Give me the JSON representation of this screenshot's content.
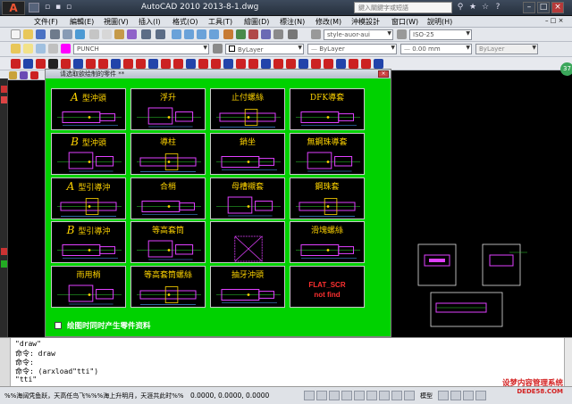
{
  "title_bar": {
    "app_button": "A",
    "title": "AutoCAD 2010    2013-8-1.dwg",
    "search_placeholder": "鍵入關鍵字或短語"
  },
  "menu": [
    "文件(F)",
    "編輯(E)",
    "視圖(V)",
    "插入(I)",
    "格式(O)",
    "工具(T)",
    "繪圖(D)",
    "標注(N)",
    "修改(M)",
    "沖模設計",
    "窗口(W)",
    "說明(H)"
  ],
  "toolbars": {
    "text_style": "style-auor-aui",
    "dim_style": "ISO-25",
    "layer": "PUNCH",
    "color": "ByLayer",
    "linetype": "ByLayer",
    "lineweight": "0.00 mm",
    "plot_style": "ByLayer"
  },
  "dialog": {
    "title": "请选取欲绘制的零件  **",
    "close": "×",
    "cells": [
      {
        "prefix": "A",
        "label": "型沖頭"
      },
      {
        "prefix": "",
        "label": "浮升"
      },
      {
        "prefix": "",
        "label": "止付螺絲"
      },
      {
        "prefix": "",
        "label": "DFK導套"
      },
      {
        "prefix": "B",
        "label": "型沖頭"
      },
      {
        "prefix": "",
        "label": "導柱"
      },
      {
        "prefix": "",
        "label": "銷坐"
      },
      {
        "prefix": "",
        "label": "無鋼珠導套"
      },
      {
        "prefix": "A",
        "label": "型引導沖"
      },
      {
        "prefix": "",
        "label": "合梢"
      },
      {
        "prefix": "",
        "label": "母槽襯套"
      },
      {
        "prefix": "",
        "label": "鋼珠套"
      },
      {
        "prefix": "B",
        "label": "型引導沖"
      },
      {
        "prefix": "",
        "label": "等高套筒"
      },
      {
        "prefix": "",
        "label": ""
      },
      {
        "prefix": "",
        "label": "滑塊螺絲"
      },
      {
        "prefix": "",
        "label": "雨用梢"
      },
      {
        "prefix": "",
        "label": "等高套筒螺絲"
      },
      {
        "prefix": "",
        "label": "抽牙沖頭"
      },
      {
        "prefix": "",
        "label": "FLAT_SCR",
        "sub": "not find"
      }
    ],
    "checkbox_label": "绘图时同时产生零件资料"
  },
  "nav_badge": "37",
  "command": {
    "lines": [
      "\"draw\"",
      "命令: draw",
      "命令:",
      "命令: (arxload\"tti\")",
      "\"tti\""
    ]
  },
  "status": {
    "text": "%%海阔凭鱼跃，天高任鸟飞%%%海上升明月，天涯共此时%%",
    "coords": "0.0000,   0.0000,   0.0000",
    "model": "模型"
  },
  "watermark": {
    "line1": "设梦内容管理系统",
    "line2": "DEDE58.COM"
  },
  "colors": {
    "dialog_bg": "#00d200",
    "drawing_magenta": "#e040ff",
    "title_yellow": "#ffd400"
  }
}
